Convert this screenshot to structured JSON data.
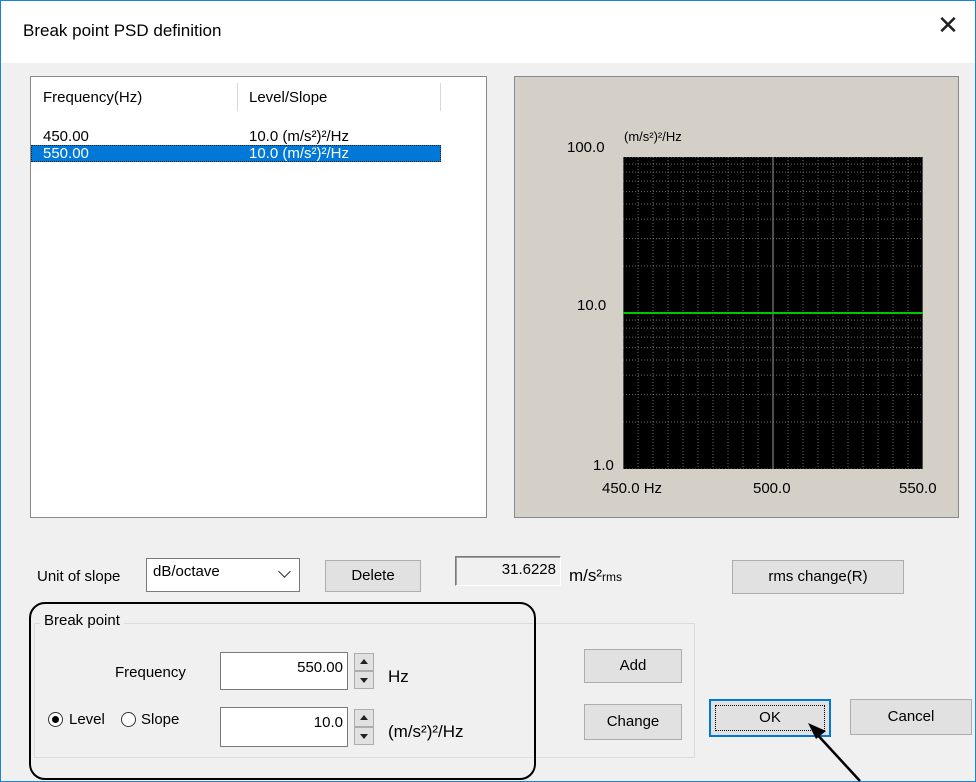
{
  "window": {
    "title": "Break point PSD definition"
  },
  "list": {
    "columns": [
      "Frequency(Hz)",
      "Level/Slope"
    ],
    "rows": [
      {
        "freq": "450.00",
        "level": "10.0 (m/s²)²/Hz",
        "selected": false
      },
      {
        "freq": "550.00",
        "level": "10.0 (m/s²)²/Hz",
        "selected": true
      }
    ]
  },
  "graph": {
    "y_unit": "(m/s²)²/Hz",
    "y_ticks": [
      "100.0",
      "10.0",
      "1.0"
    ],
    "x_ticks": [
      "450.0 Hz",
      "500.0",
      "550.0"
    ],
    "background": "#000000",
    "line_color": "#00c800",
    "grid_color": "#6e6e6e"
  },
  "chart_data": {
    "type": "line",
    "xscale": "linear",
    "yscale": "log",
    "xlim": [
      450,
      550
    ],
    "ylim": [
      1,
      100
    ],
    "x_ticks": [
      "450.0 Hz",
      "500.0",
      "550.0"
    ],
    "y_ticks": [
      "100.0",
      "10.0",
      "1.0"
    ],
    "ylabel": "(m/s²)²/Hz",
    "series": [
      {
        "x": [
          450,
          550
        ],
        "y": [
          10.0,
          10.0
        ]
      }
    ]
  },
  "controls": {
    "unit_of_slope_label": "Unit of slope",
    "unit_of_slope_value": "dB/octave",
    "delete_label": "Delete",
    "rms_value": "31.6228",
    "rms_unit_main": "m/s²",
    "rms_unit_sub": "rms",
    "rms_change_label": "rms change(R)",
    "breakpoint_group_title": "Break point",
    "frequency_label": "Frequency",
    "frequency_value": "550.00",
    "frequency_unit": "Hz",
    "level_label": "Level",
    "slope_label": "Slope",
    "level_value": "10.0",
    "level_unit": "(m/s²)²/Hz",
    "add_label": "Add",
    "change_label": "Change",
    "ok_label": "OK",
    "cancel_label": "Cancel",
    "mode_selected": "Level"
  }
}
